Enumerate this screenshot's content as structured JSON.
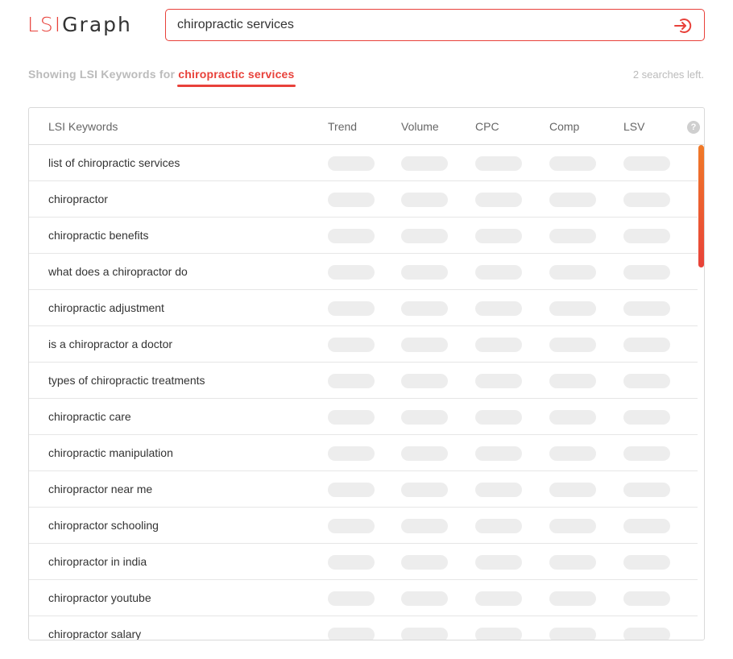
{
  "brand": {
    "logo_part1": "LSI",
    "logo_part2": "Graph",
    "accent_color": "#e8413a"
  },
  "search": {
    "value": "chiropractic services",
    "submit_icon": "arrow-into-circle-icon"
  },
  "summary": {
    "prefix": "Showing LSI Keywords for",
    "query": "chiropractic services",
    "searches_left": "2 searches left."
  },
  "table": {
    "columns": [
      "LSI Keywords",
      "Trend",
      "Volume",
      "CPC",
      "Comp",
      "LSV"
    ],
    "help_icon": "question-mark-icon",
    "help_glyph": "?",
    "rows": [
      "list of chiropractic services",
      "chiropractor",
      "chiropractic benefits",
      "what does a chiropractor do",
      "chiropractic adjustment",
      "is a chiropractor a doctor",
      "types of chiropractic treatments",
      "chiropractic care",
      "chiropractic manipulation",
      "chiropractor near me",
      "chiropractor schooling",
      "chiropractor in india",
      "chiropractor youtube",
      "chiropractor salary"
    ]
  }
}
